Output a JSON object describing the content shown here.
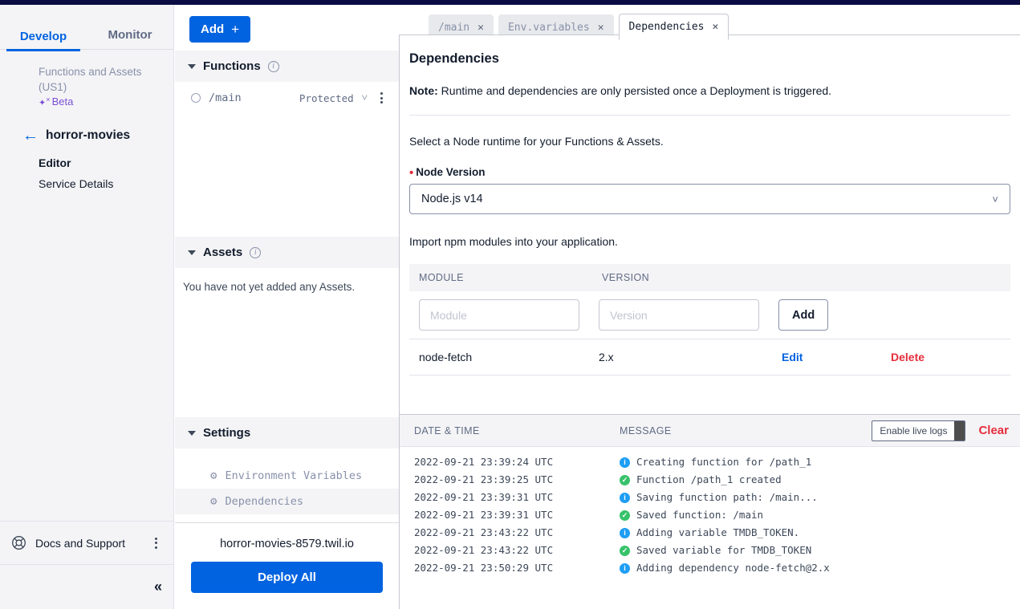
{
  "theme": {
    "top_strip": "#0b0c44",
    "accent_blue": "#0263e0",
    "danger_red": "#e52d3c",
    "beta_purple": "#7b4fd6",
    "info_blue": "#1e9ef4",
    "success_green": "#36c26a",
    "panel_gray": "#f4f4f6"
  },
  "sidebar": {
    "tabs": [
      {
        "label": "Develop",
        "active": true
      },
      {
        "label": "Monitor",
        "active": false
      }
    ],
    "product_line1": "Functions and Assets",
    "product_line2": "(US1)",
    "beta_label": "Beta",
    "beta_icon": "sparkle-icon",
    "back_icon": "arrow-left-icon",
    "service_name": "horror-movies",
    "links": [
      {
        "label": "Editor",
        "bold": true
      },
      {
        "label": "Service Details",
        "bold": false
      }
    ],
    "docs": {
      "icon": "lifebuoy-icon",
      "label": "Docs and Support",
      "kebab_icon": "kebab-menu-icon"
    },
    "collapse_icon": "«"
  },
  "midpanel": {
    "add_button": {
      "label": "Add",
      "plus": "+"
    },
    "functions": {
      "title": "Functions",
      "info_icon": "info-icon",
      "caret_icon": "caret-down-icon",
      "rows": [
        {
          "status_icon": "circle-outline-icon",
          "path": "/main",
          "visibility": "Protected",
          "chevron_icon": "chevron-down-icon",
          "kebab_icon": "kebab-menu-icon"
        }
      ]
    },
    "assets": {
      "title": "Assets",
      "info_icon": "info-icon",
      "caret_icon": "caret-down-icon",
      "empty_text": "You have not yet added any Assets."
    },
    "settings": {
      "title": "Settings",
      "caret_icon": "caret-down-icon",
      "items": [
        {
          "icon": "gear-icon",
          "label": "Environment Variables",
          "selected": false
        },
        {
          "icon": "gear-icon",
          "label": "Dependencies",
          "selected": true
        }
      ]
    },
    "deploy": {
      "url": "horror-movies-8579.twil.io",
      "button_label": "Deploy All"
    }
  },
  "editor_tabs": [
    {
      "label": "/main",
      "active": false,
      "close_icon": "close-icon"
    },
    {
      "label": "Env.variables",
      "active": false,
      "close_icon": "close-icon"
    },
    {
      "label": "Dependencies",
      "active": true,
      "close_icon": "close-icon"
    }
  ],
  "content": {
    "title": "Dependencies",
    "note_prefix": "Note:",
    "note_text": " Runtime and dependencies are only persisted once a Deployment is triggered.",
    "runtime_intro": "Select a Node runtime for your Functions & Assets.",
    "node_version": {
      "required_marker": "•",
      "label": "Node Version",
      "value": "Node.js v14",
      "chevron_icon": "chevron-down-icon"
    },
    "modules_intro": "Import npm modules into your application.",
    "table": {
      "headers": [
        "MODULE",
        "VERSION"
      ],
      "module_placeholder": "Module",
      "module_value": "",
      "version_placeholder": "Version",
      "version_value": "",
      "add_label": "Add",
      "rows": [
        {
          "module": "node-fetch",
          "version": "2.x",
          "edit_label": "Edit",
          "delete_label": "Delete"
        }
      ]
    }
  },
  "logs": {
    "headers": [
      "DATE & TIME",
      "MESSAGE"
    ],
    "live_logs_label": "Enable live logs",
    "clear_label": "Clear",
    "entries": [
      {
        "timestamp": "2022-09-21 23:39:24 UTC",
        "level": "info",
        "icon": "info-badge-icon",
        "message": "Creating function for /path_1"
      },
      {
        "timestamp": "2022-09-21 23:39:25 UTC",
        "level": "success",
        "icon": "check-badge-icon",
        "message": "Function /path_1 created"
      },
      {
        "timestamp": "2022-09-21 23:39:31 UTC",
        "level": "info",
        "icon": "info-badge-icon",
        "message": "Saving function path: /main..."
      },
      {
        "timestamp": "2022-09-21 23:39:31 UTC",
        "level": "success",
        "icon": "check-badge-icon",
        "message": "Saved function: /main"
      },
      {
        "timestamp": "2022-09-21 23:43:22 UTC",
        "level": "info",
        "icon": "info-badge-icon",
        "message": "Adding variable TMDB_TOKEN."
      },
      {
        "timestamp": "2022-09-21 23:43:22 UTC",
        "level": "success",
        "icon": "check-badge-icon",
        "message": "Saved variable for TMDB_TOKEN"
      },
      {
        "timestamp": "2022-09-21 23:50:29 UTC",
        "level": "info",
        "icon": "info-badge-icon",
        "message": "Adding dependency node-fetch@2.x"
      }
    ]
  }
}
